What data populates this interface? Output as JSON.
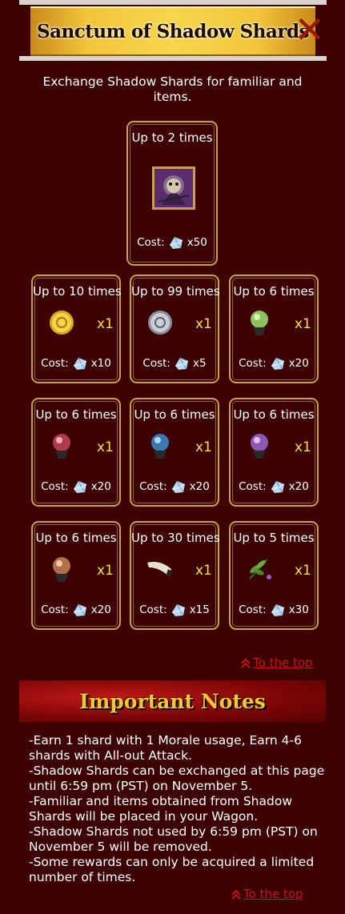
{
  "header": {
    "title": "Sanctum of Shadow Shards",
    "intro": "Exchange Shadow Shards for familiar and items."
  },
  "cost_label": "Cost:",
  "featured": {
    "limit": "Up to 2 times",
    "item_icon": "familiar-portrait",
    "cost": "x50"
  },
  "rewards": [
    {
      "limit": "Up to 10 times",
      "item_icon": "gold-coin",
      "qty": "x1",
      "cost": "x10"
    },
    {
      "limit": "Up to 99 times",
      "item_icon": "silver-coin",
      "qty": "x1",
      "cost": "x5"
    },
    {
      "limit": "Up to 6 times",
      "item_icon": "green-orb",
      "qty": "x1",
      "cost": "x20"
    },
    {
      "limit": "Up to 6 times",
      "item_icon": "red-orb",
      "qty": "x1",
      "cost": "x20"
    },
    {
      "limit": "Up to 6 times",
      "item_icon": "blue-orb",
      "qty": "x1",
      "cost": "x20"
    },
    {
      "limit": "Up to 6 times",
      "item_icon": "purple-orb",
      "qty": "x1",
      "cost": "x20"
    },
    {
      "limit": "Up to 6 times",
      "item_icon": "bronze-orb",
      "qty": "x1",
      "cost": "x20"
    },
    {
      "limit": "Up to 30 times",
      "item_icon": "horn",
      "qty": "x1",
      "cost": "x15"
    },
    {
      "limit": "Up to 5 times",
      "item_icon": "herb",
      "qty": "x1",
      "cost": "x30"
    }
  ],
  "to_top": "To the top",
  "notes": {
    "title": "Important Notes",
    "lines": [
      "-Earn 1 shard with 1 Morale usage, Earn 4-6 shards with All-out Attack.",
      "-Shadow Shards can be exchanged at this page until 6:59 pm (PST) on November 5.",
      "-Familiar and items obtained from Shadow Shards will be placed in your Wagon.",
      "-Shadow Shards not used by 6:59 pm (PST) on November 5 will be removed.",
      "-Some rewards can only be acquired a limited number of times."
    ]
  },
  "colors": {
    "background": "#3d0304",
    "card_border": "#c9a04c",
    "quantity": "#f7e04a",
    "link": "#c0151a",
    "banner_gold": "#f2c53a"
  }
}
